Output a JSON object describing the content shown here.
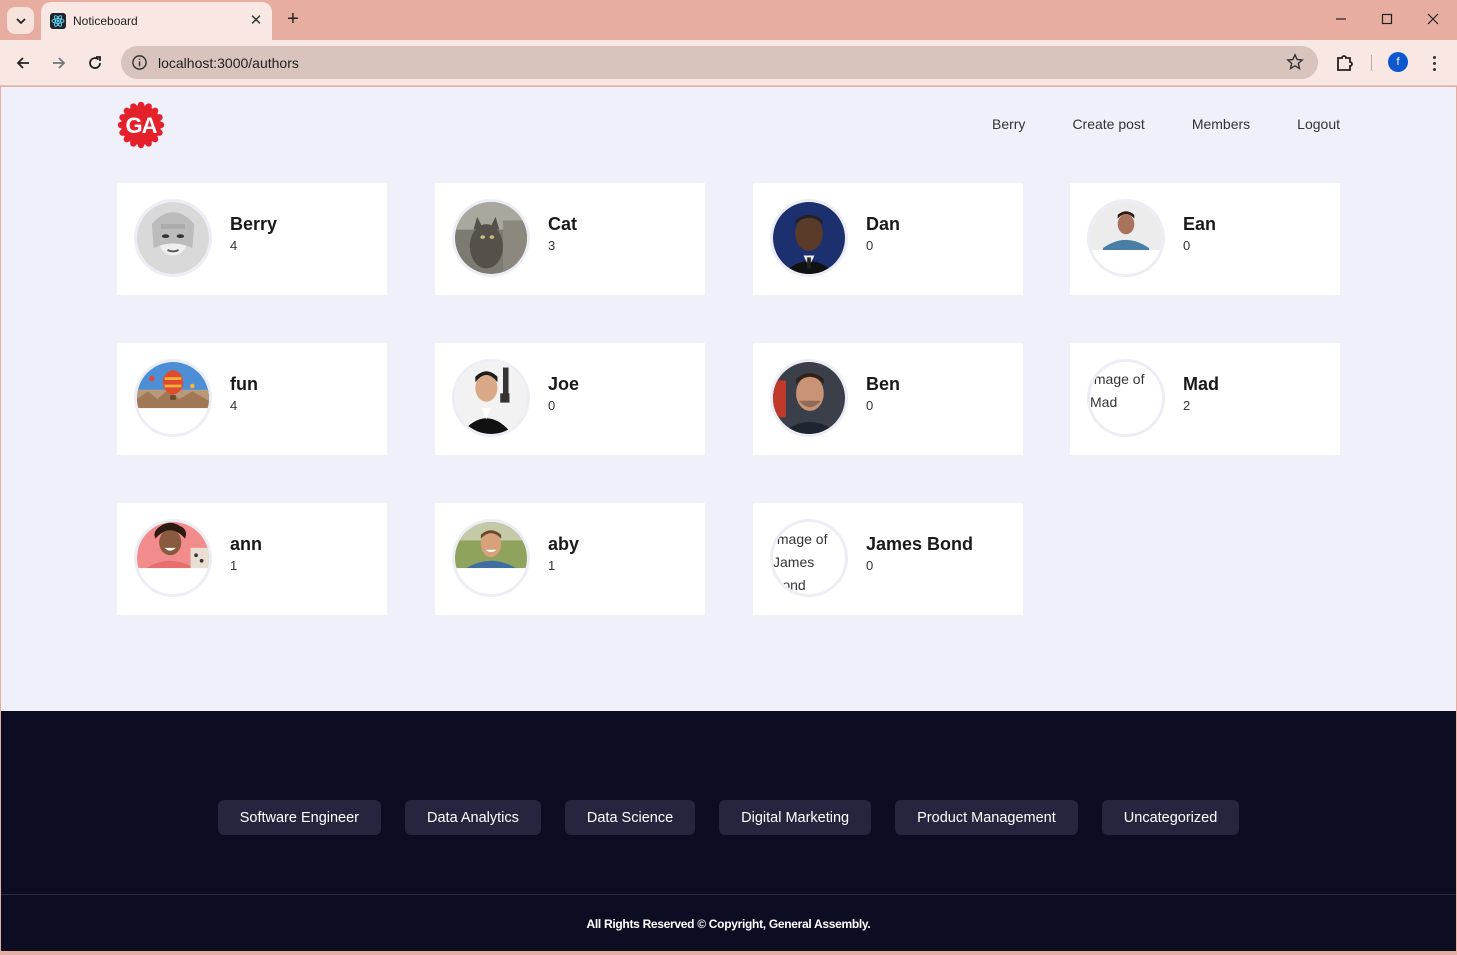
{
  "browser": {
    "tab_title": "Noticeboard",
    "url": "localhost:3000/authors",
    "profile_initial": "f",
    "new_tab_symbol": "+",
    "close_symbol": "✕"
  },
  "nav": {
    "links": [
      "Berry",
      "Create post",
      "Members",
      "Logout"
    ]
  },
  "authors": [
    {
      "name": "Berry",
      "count": "4",
      "avatar": "photo"
    },
    {
      "name": "Cat",
      "count": "3",
      "avatar": "photo"
    },
    {
      "name": "Dan",
      "count": "0",
      "avatar": "photo"
    },
    {
      "name": "Ean",
      "count": "0",
      "avatar": "photo"
    },
    {
      "name": "fun",
      "count": "4",
      "avatar": "photo"
    },
    {
      "name": "Joe",
      "count": "0",
      "avatar": "photo"
    },
    {
      "name": "Ben",
      "count": "0",
      "avatar": "photo"
    },
    {
      "name": "Mad",
      "count": "2",
      "avatar": "broken",
      "alt": "Image of Mad"
    },
    {
      "name": "ann",
      "count": "1",
      "avatar": "photo"
    },
    {
      "name": "aby",
      "count": "1",
      "avatar": "photo"
    },
    {
      "name": "James Bond",
      "count": "0",
      "avatar": "broken",
      "alt": "Image of James Bond"
    }
  ],
  "footer": {
    "categories": [
      "Software Engineer",
      "Data Analytics",
      "Data Science",
      "Digital Marketing",
      "Product Management",
      "Uncategorized"
    ],
    "copyright": "All Rights Reserved © Copyright, General Assembly."
  },
  "colors": {
    "chrome": "#e6ada0",
    "page_bg": "#f0f0fb",
    "footer_bg": "#0c0c23",
    "logo_red": "#e4202a"
  }
}
